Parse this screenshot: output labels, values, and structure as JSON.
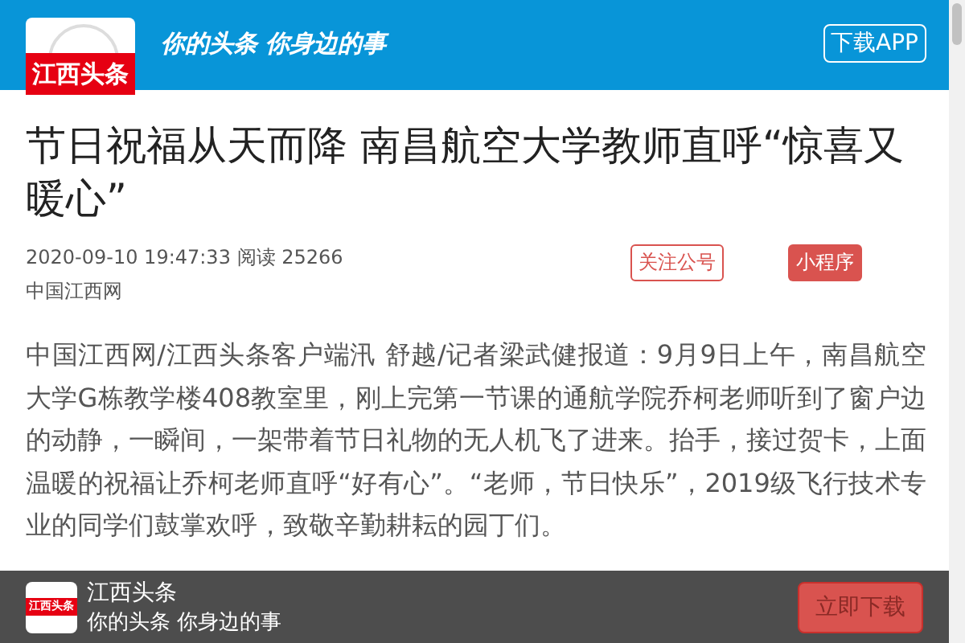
{
  "header": {
    "logo_text": "江西头条",
    "slogan": "你的头条 你身边的事",
    "download_button": "下载APP"
  },
  "article": {
    "title": "节日祝福从天而降 南昌航空大学教师直呼“惊喜又暖心”",
    "datetime": "2020-09-10 19:47:33",
    "read_label": "阅读",
    "read_count": "25266",
    "follow_button": "关注公号",
    "miniprogram_button": "小程序",
    "source": "中国江西网",
    "paragraphs": [
      "中国江西网/江西头条客户端汛 舒越/记者梁武健报道：9月9日上午，南昌航空大学G栋教学楼408教室里，刚上完第一节课的通航学院乔柯老师听到了窗户边的动静，一瞬间，一架带着节日礼物的无人机飞了进来。抬手，接过贺卡，上面温暖的祝福让乔柯老师直呼“好有心”。“老师，节日快乐”，2019级飞行技术专业的同学们鼓掌欢呼，致敬辛勤耕耘的园丁们。"
    ]
  },
  "app_banner": {
    "logo_text": "江西头条",
    "name": "江西头条",
    "tagline": "你的头条 你身边的事",
    "button": "立即下载"
  }
}
